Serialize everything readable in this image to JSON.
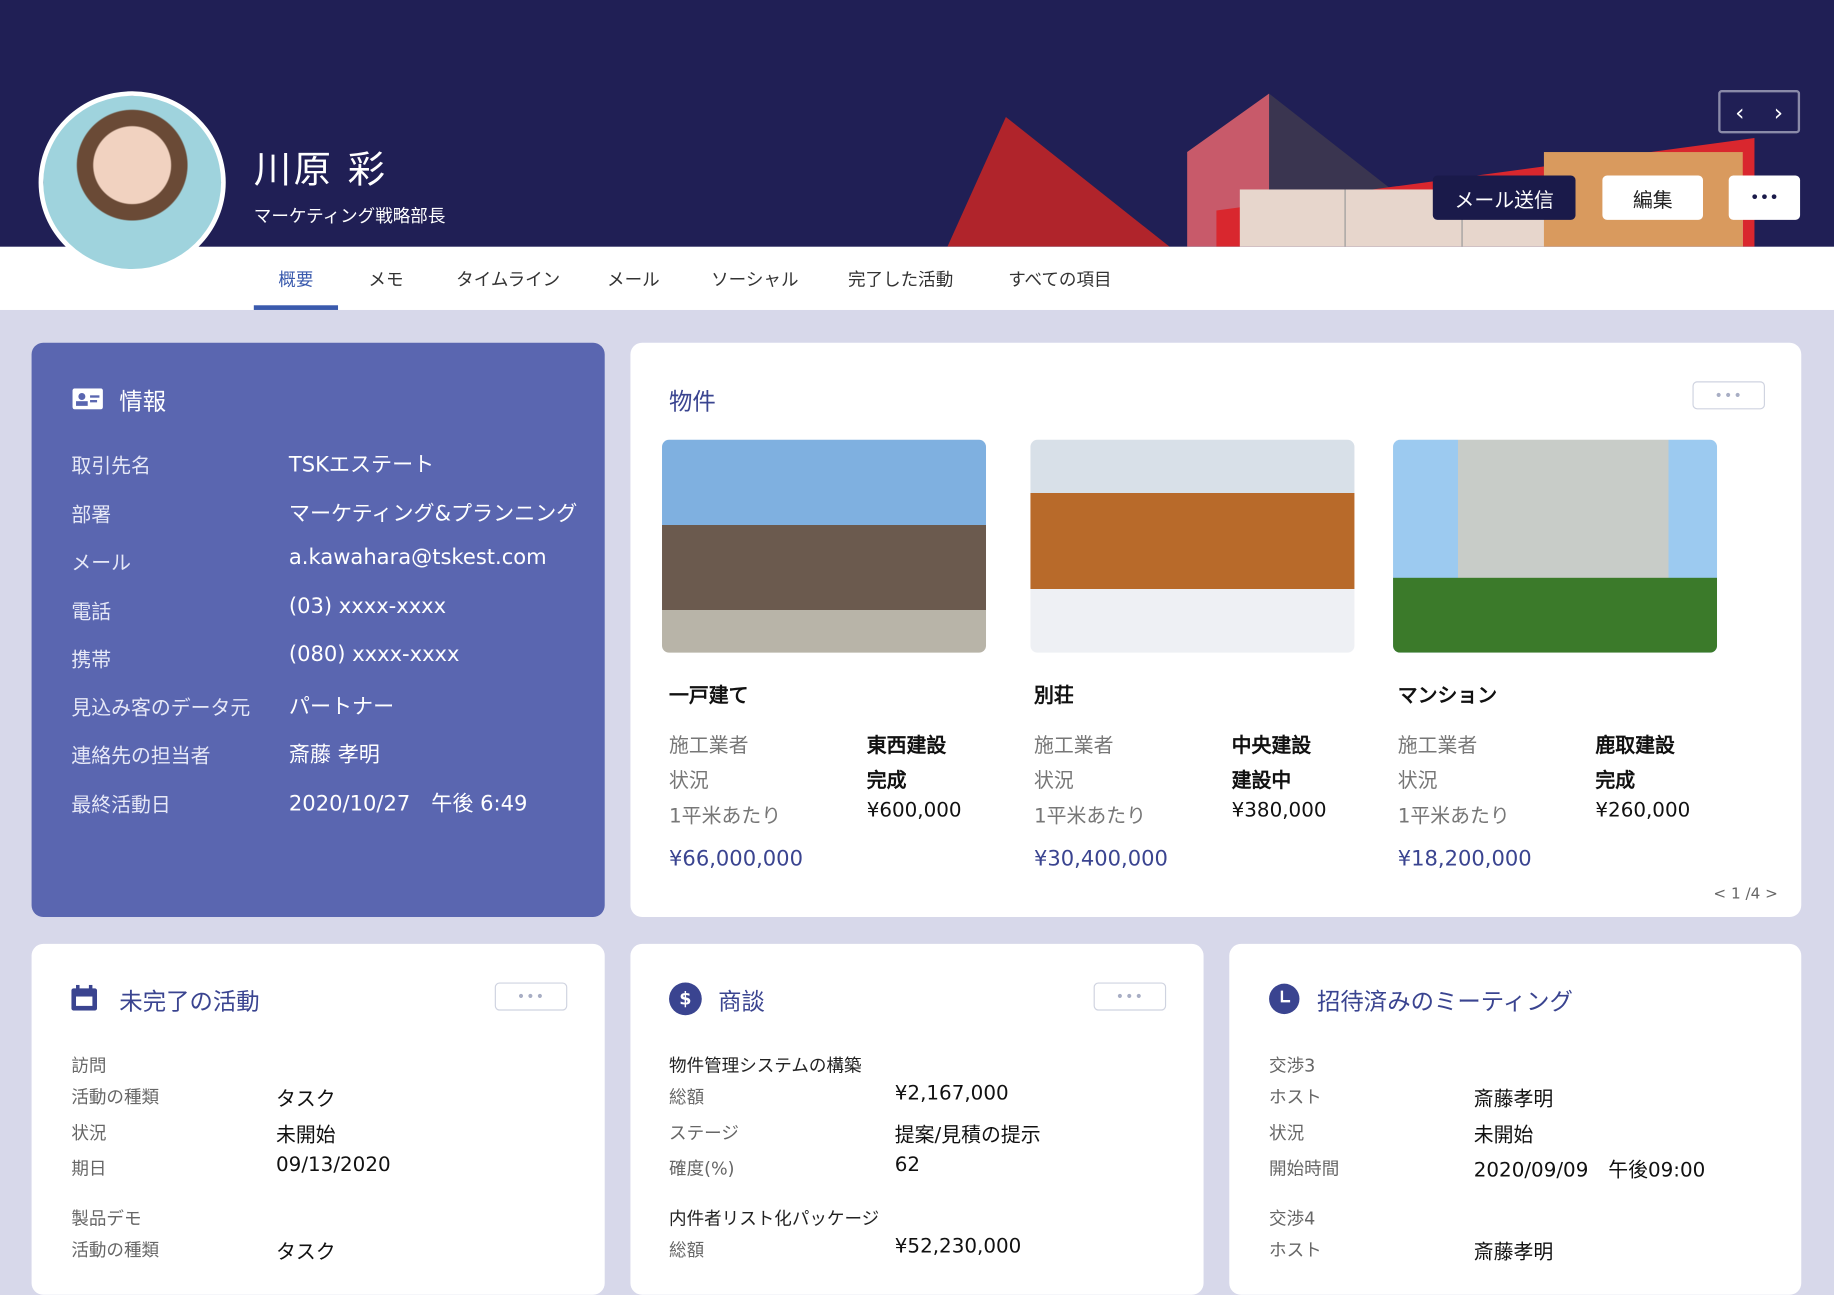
{
  "header": {
    "name": "川原 彩",
    "job_title": "マーケティング戦略部長",
    "prev": "‹",
    "next": "›",
    "send_mail": "メール送信",
    "edit": "編集",
    "more": "•••"
  },
  "tabs": [
    "概要",
    "メモ",
    "タイムライン",
    "メール",
    "ソーシャル",
    "完了した活動",
    "すべての項目"
  ],
  "info": {
    "title": "情報",
    "rows": [
      {
        "label": "取引先名",
        "value": "TSKエステート"
      },
      {
        "label": "部署",
        "value": "マーケティング&プランニング"
      },
      {
        "label": "メール",
        "value": "a.kawahara@tskest.com"
      },
      {
        "label": "電話",
        "value": "(03) xxxx-xxxx"
      },
      {
        "label": "携帯",
        "value": "(080) xxxx-xxxx"
      },
      {
        "label": "見込み客のデータ元",
        "value": "パートナー"
      },
      {
        "label": "連絡先の担当者",
        "value": "斎藤 孝明"
      },
      {
        "label": "最終活動日",
        "value": "2020/10/27　午後 6:49"
      }
    ]
  },
  "properties": {
    "title": "物件",
    "more": "•••",
    "pagination": "< 1 /4 >",
    "items": [
      {
        "name": "一戸建て",
        "builder_label": "施工業者",
        "builder": "東西建設",
        "status_label": "状況",
        "status": "完成",
        "unit_label": "1平米あたり",
        "unit_price": "¥600,000",
        "price": "¥66,000,000"
      },
      {
        "name": "別荘",
        "builder_label": "施工業者",
        "builder": "中央建設",
        "status_label": "状況",
        "status": "建設中",
        "unit_label": "1平米あたり",
        "unit_price": "¥380,000",
        "price": "¥30,400,000"
      },
      {
        "name": "マンション",
        "builder_label": "施工業者",
        "builder": "鹿取建設",
        "status_label": "状況",
        "status": "完成",
        "unit_label": "1平米あたり",
        "unit_price": "¥260,000",
        "price": "¥18,200,000"
      }
    ]
  },
  "activities": {
    "title": "未完了の活動",
    "more": "•••",
    "groups": [
      {
        "title": "訪問",
        "rows": [
          {
            "label": "活動の種類",
            "value": "タスク"
          },
          {
            "label": "状況",
            "value": "未開始"
          },
          {
            "label": "期日",
            "value": "09/13/2020"
          }
        ]
      },
      {
        "title": "製品デモ",
        "rows": [
          {
            "label": "活動の種類",
            "value": "タスク"
          }
        ]
      }
    ]
  },
  "deals": {
    "title": "商談",
    "more": "•••",
    "groups": [
      {
        "title": "物件管理システムの構築",
        "rows": [
          {
            "label": "総額",
            "value": "¥2,167,000"
          },
          {
            "label": "ステージ",
            "value": "提案/見積の提示"
          },
          {
            "label": "確度(%)",
            "value": "62"
          }
        ]
      },
      {
        "title": "内件者リスト化パッケージ",
        "rows": [
          {
            "label": "総額",
            "value": "¥52,230,000"
          }
        ]
      }
    ]
  },
  "meetings": {
    "title": "招待済みのミーティング",
    "groups": [
      {
        "title": "交渉3",
        "rows": [
          {
            "label": "ホスト",
            "value": "斎藤孝明"
          },
          {
            "label": "状況",
            "value": "未開始"
          },
          {
            "label": "開始時間",
            "value": "2020/09/09　午後09:00"
          }
        ]
      },
      {
        "title": "交渉4",
        "rows": [
          {
            "label": "ホスト",
            "value": "斎藤孝明"
          }
        ]
      }
    ]
  }
}
